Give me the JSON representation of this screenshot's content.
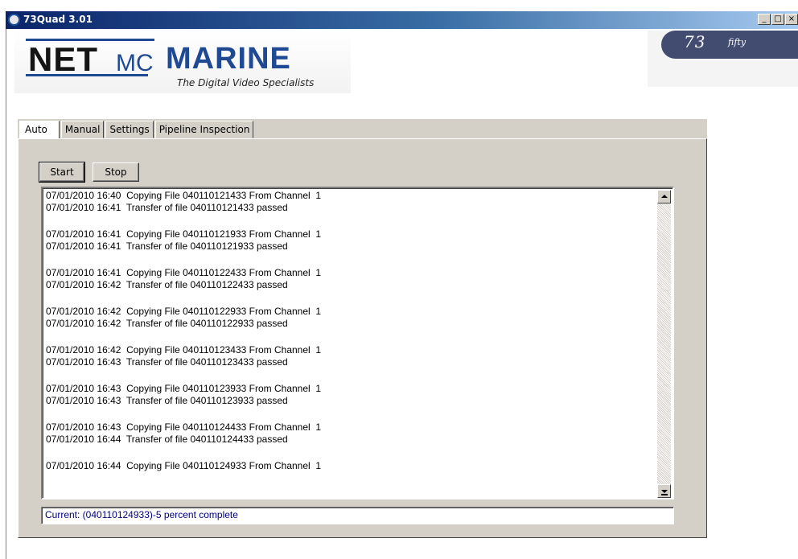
{
  "window": {
    "title": "73Quad 3.01",
    "controls": {
      "minimize": "_",
      "maximize": "□",
      "close": "×"
    }
  },
  "branding": {
    "logo_net": "NET",
    "logo_mc": "MC",
    "logo_marine": "MARINE",
    "tagline": "The Digital Video Specialists",
    "badge_main": "73",
    "badge_sub": "fifty"
  },
  "tabs": [
    {
      "label": "Auto",
      "active": true
    },
    {
      "label": "Manual",
      "active": false
    },
    {
      "label": "Settings",
      "active": false
    },
    {
      "label": "Pipeline Inspection",
      "active": false
    }
  ],
  "auto": {
    "start_label": "Start",
    "stop_label": "Stop",
    "log_entries": [
      {
        "datetime": "07/01/2010 16:40",
        "message": "Copying File 040110121433 From Channel  1"
      },
      {
        "datetime": "07/01/2010 16:41",
        "message": "Transfer of file 040110121433 passed"
      },
      {
        "datetime": "07/01/2010 16:41",
        "message": "Copying File 040110121933 From Channel  1"
      },
      {
        "datetime": "07/01/2010 16:41",
        "message": "Transfer of file 040110121933 passed"
      },
      {
        "datetime": "07/01/2010 16:41",
        "message": "Copying File 040110122433 From Channel  1"
      },
      {
        "datetime": "07/01/2010 16:42",
        "message": "Transfer of file 040110122433 passed"
      },
      {
        "datetime": "07/01/2010 16:42",
        "message": "Copying File 040110122933 From Channel  1"
      },
      {
        "datetime": "07/01/2010 16:42",
        "message": "Transfer of file 040110122933 passed"
      },
      {
        "datetime": "07/01/2010 16:42",
        "message": "Copying File 040110123433 From Channel  1"
      },
      {
        "datetime": "07/01/2010 16:43",
        "message": "Transfer of file 040110123433 passed"
      },
      {
        "datetime": "07/01/2010 16:43",
        "message": "Copying File 040110123933 From Channel  1"
      },
      {
        "datetime": "07/01/2010 16:43",
        "message": "Transfer of file 040110123933 passed"
      },
      {
        "datetime": "07/01/2010 16:43",
        "message": "Copying File 040110124433 From Channel  1"
      },
      {
        "datetime": "07/01/2010 16:44",
        "message": "Transfer of file 040110124433 passed"
      },
      {
        "datetime": "07/01/2010 16:44",
        "message": "Copying File 040110124933 From Channel  1"
      }
    ],
    "status": "Current: (040110124933)-5 percent complete"
  },
  "colors": {
    "titlebar_start": "#0a246a",
    "titlebar_end": "#a6caf0",
    "brand_blue": "#1f4a93",
    "badge_bg": "#414c70",
    "status_text": "#000080"
  },
  "icons": {
    "app": "app-icon",
    "scroll_up": "scroll-up-arrow-icon",
    "scroll_down": "scroll-down-arrow-icon"
  }
}
